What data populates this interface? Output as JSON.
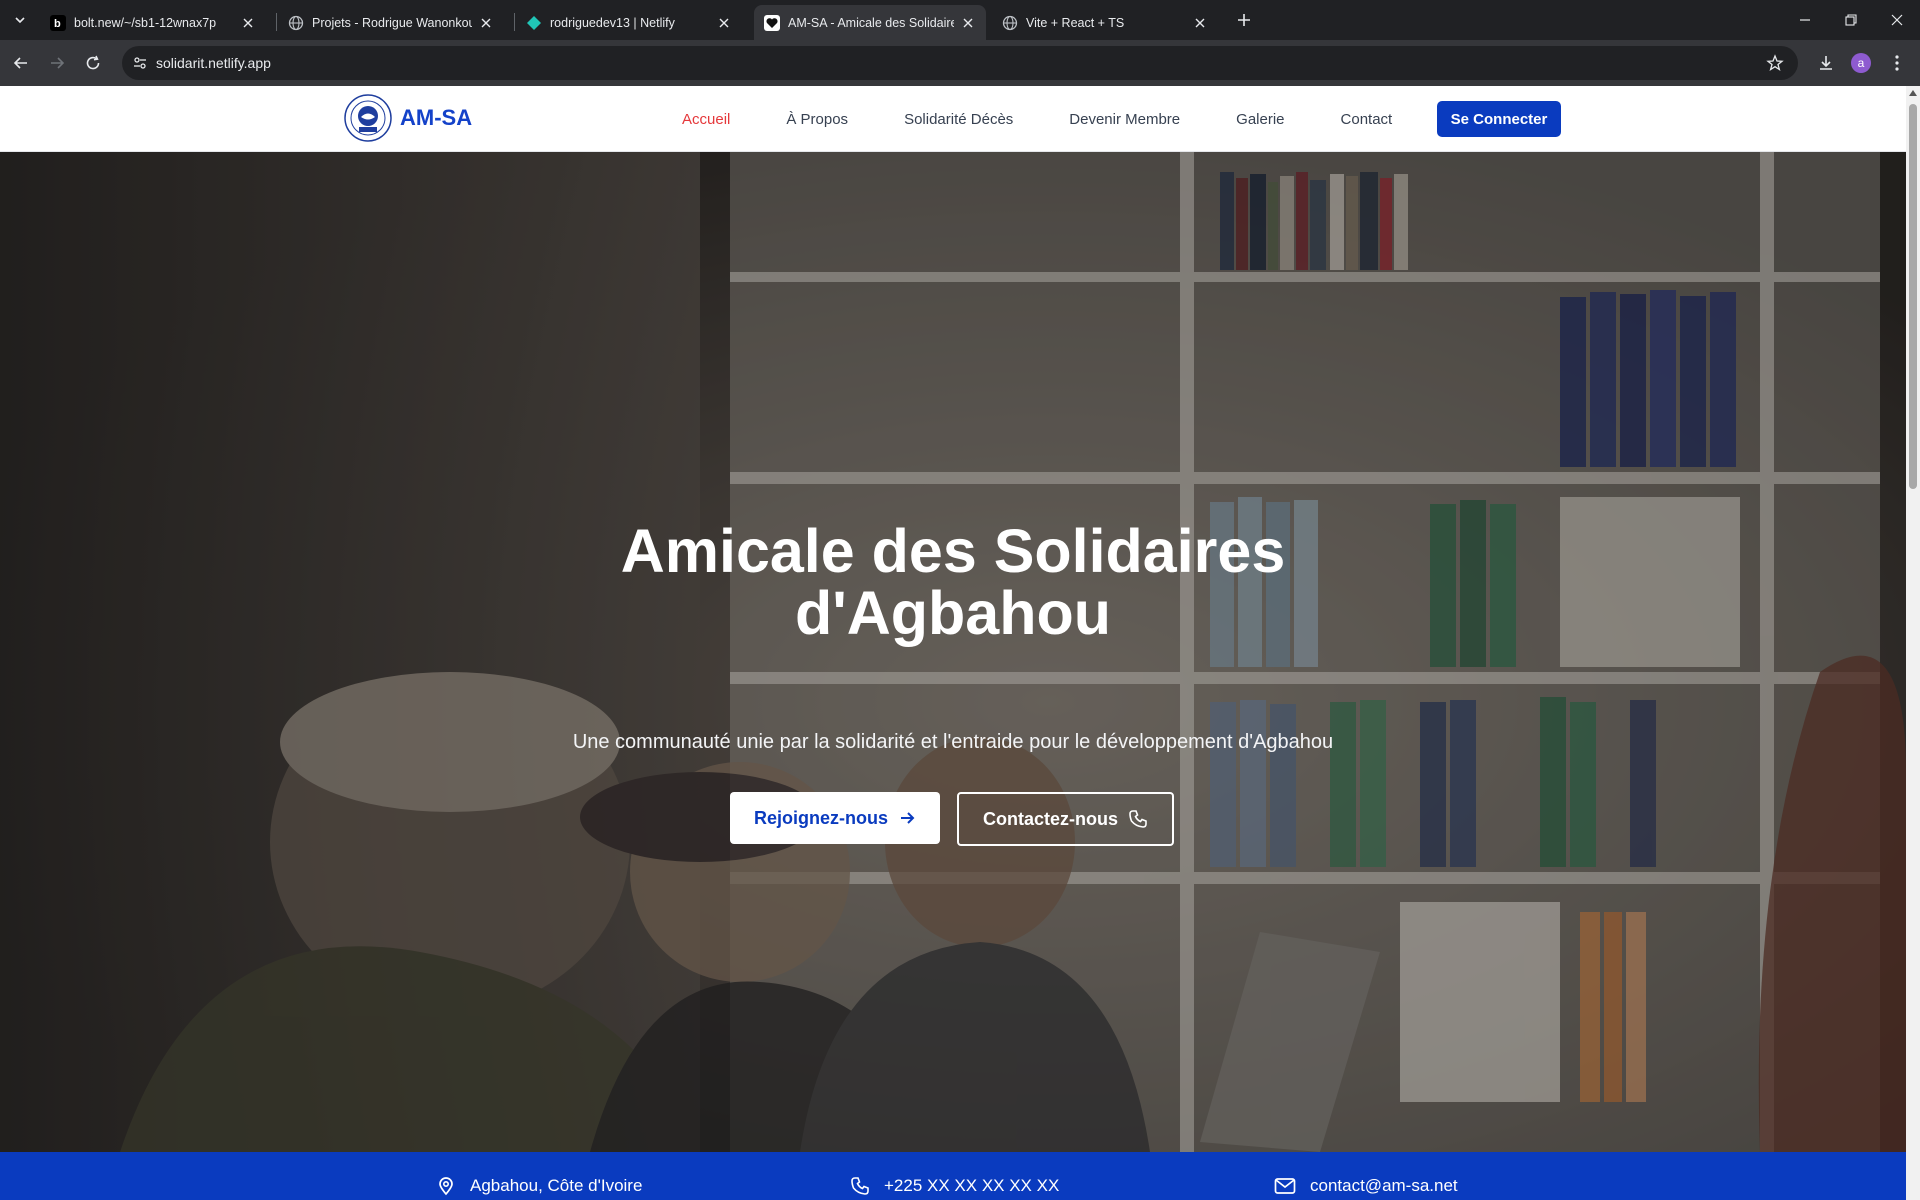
{
  "browser": {
    "tabs": [
      {
        "title": "bolt.new/~/sb1-12wnax7p",
        "icon": "bolt-favicon"
      },
      {
        "title": "Projets - Rodrigue Wanonkou",
        "icon": "globe-favicon"
      },
      {
        "title": "rodriguedev13 | Netlify",
        "icon": "netlify-favicon"
      },
      {
        "title": "AM-SA - Amicale des Solidaires d'Agbahou",
        "icon": "heart-favicon",
        "active": true
      },
      {
        "title": "Vite + React + TS",
        "icon": "globe-favicon"
      }
    ],
    "url": "solidarit.netlify.app",
    "profile_initial": "a"
  },
  "site": {
    "brand": "AM-SA",
    "nav": [
      "Accueil",
      "À Propos",
      "Solidarité Décès",
      "Devenir Membre",
      "Galerie",
      "Contact"
    ],
    "login": "Se Connecter",
    "colors": {
      "primary": "#0a3bbf",
      "active_nav": "#e5383b"
    }
  },
  "hero": {
    "title_line1": "Amicale des Solidaires",
    "title_line2": "d'Agbahou",
    "subtitle": "Une communauté unie par la solidarité et l'entraide pour le développement d'Agbahou",
    "cta_primary": "Rejoignez-nous",
    "cta_secondary": "Contactez-nous"
  },
  "contact_bar": {
    "address": "Agbahou, Côte d'Ivoire",
    "phone": "+225 XX XX XX XX XX",
    "email": "contact@am-sa.net"
  }
}
